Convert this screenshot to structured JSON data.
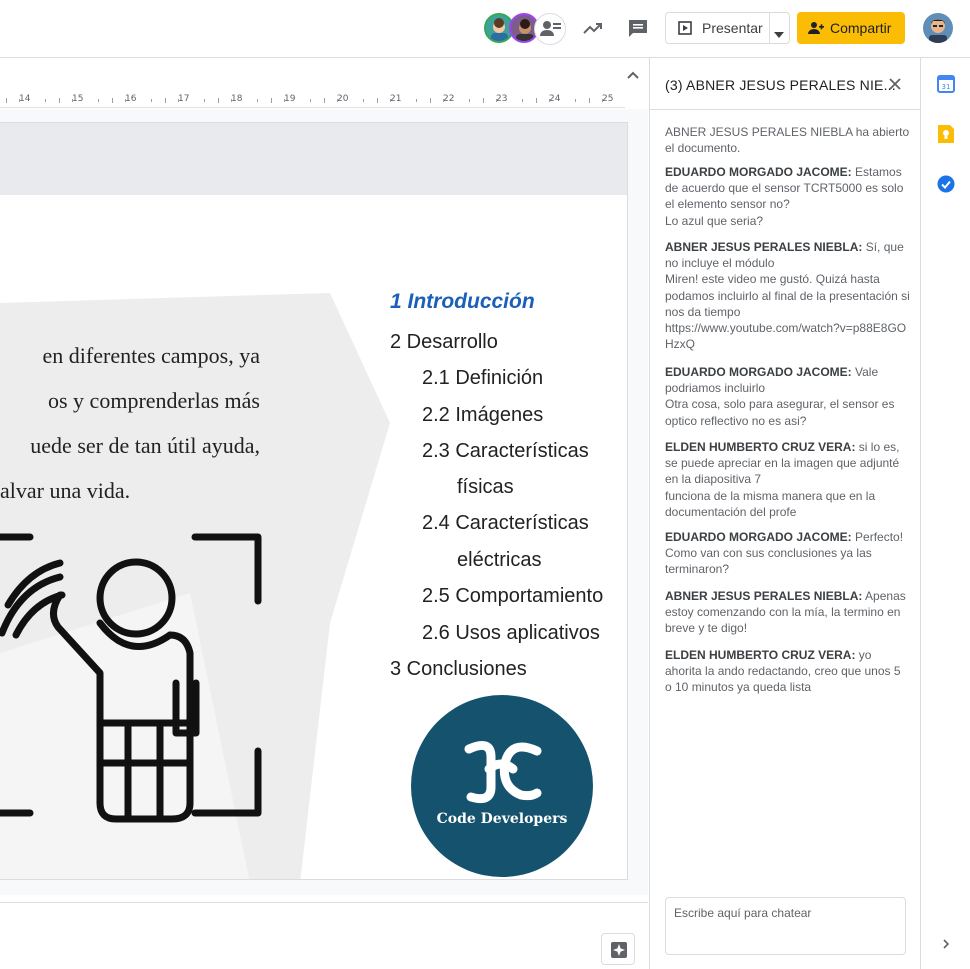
{
  "topbar": {
    "present_label": "Presentar",
    "share_label": "Compartir"
  },
  "ruler": {
    "ticks": [
      "14",
      "15",
      "16",
      "17",
      "18",
      "19",
      "20",
      "21",
      "22",
      "23",
      "24",
      "25"
    ]
  },
  "slide": {
    "body_lines": [
      "en diferentes campos, ya",
      "os  y  comprenderlas  más",
      "uede ser de tan útil ayuda,",
      "alvar una vida."
    ],
    "toc": {
      "item1": "1 Introducción",
      "item2": "2 Desarrollo",
      "item2_1": "2.1 Definición",
      "item2_2": "2.2 Imágenes",
      "item2_3a": "2.3 Características",
      "item2_3b": "físicas",
      "item2_4a": "2.4 Características",
      "item2_4b": "eléctricas",
      "item2_5": "2.5 Comportamiento",
      "item2_6": "2.6 Usos aplicativos",
      "item3": "3 Conclusiones"
    },
    "logo_text": "Code Developers"
  },
  "chat": {
    "title": "(3) ABNER JESUS PERALES NIE...",
    "system_message": "ABNER JESUS PERALES NIEBLA ha abierto el documento.",
    "messages": [
      {
        "author": "EDUARDO MORGADO JACOME:",
        "lines": [
          "Estamos de acuerdo que el sensor TCRT5000 es solo el elemento sensor no?",
          "Lo azul que seria?"
        ]
      },
      {
        "author": "ABNER JESUS PERALES NIEBLA:",
        "lines": [
          "Sí, que no incluye el módulo",
          "Miren! este video me gustó. Quizá hasta podamos incluirlo al final de la presentación si nos da tiempo",
          "https://www.youtube.com/watch?v=p88E8GOHzxQ"
        ]
      },
      {
        "author": "EDUARDO MORGADO JACOME:",
        "lines": [
          "Vale podriamos incluirlo",
          "Otra cosa, solo para asegurar, el sensor es optico reflectivo no es asi?"
        ]
      },
      {
        "author": "ELDEN HUMBERTO CRUZ VERA:",
        "lines": [
          "si lo es, se puede apreciar en la imagen que adjunté en la diapositiva 7",
          "funciona de la misma manera que en la documentación del profe"
        ]
      },
      {
        "author": "EDUARDO MORGADO JACOME:",
        "lines": [
          "Perfecto!",
          "Como van con sus conclusiones ya las terminaron?"
        ]
      },
      {
        "author": "ABNER JESUS PERALES NIEBLA:",
        "lines": [
          "Apenas estoy comenzando con la mía, la termino en breve y te digo!"
        ]
      },
      {
        "author": "ELDEN HUMBERTO CRUZ VERA:",
        "lines": [
          "yo ahorita la ando redactando, creo que unos 5 o 10 minutos ya queda lista"
        ]
      }
    ],
    "input_placeholder": "Escribe aquí para chatear"
  },
  "colors": {
    "share_bg": "#fbbc04",
    "toc_active": "#1c5fb8",
    "logo_bg": "#14526e"
  },
  "icons": [
    "trending-icon",
    "comment-icon",
    "present-icon",
    "dropdown-icon",
    "person-add-icon",
    "collapse-icon",
    "close-icon",
    "calendar-icon",
    "keep-icon",
    "tasks-icon",
    "expand-icon",
    "explore-icon"
  ]
}
